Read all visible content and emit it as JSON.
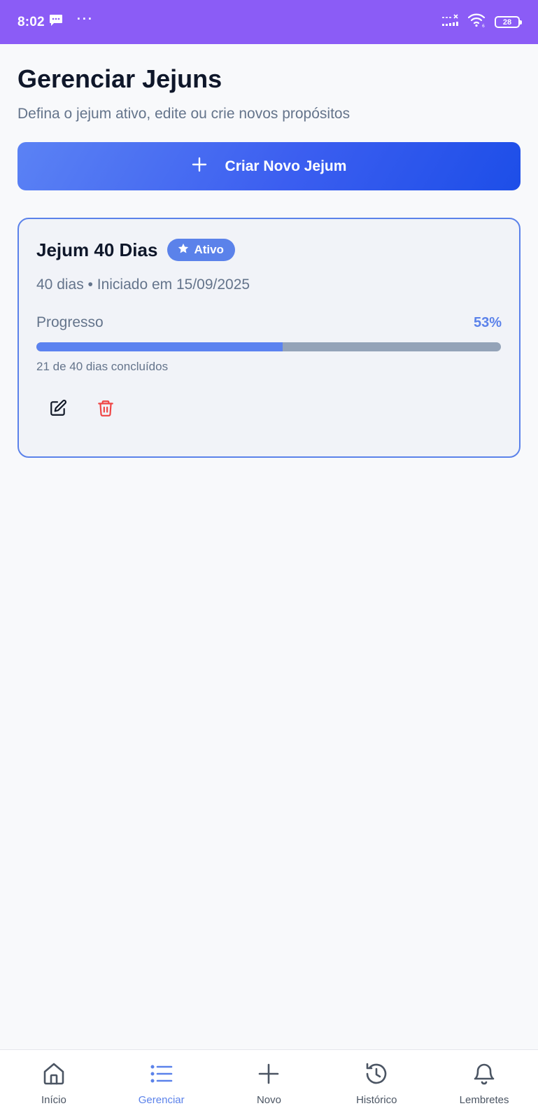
{
  "status_bar": {
    "time": "8:02",
    "overflow": "···",
    "battery": "28",
    "icons": [
      "message-icon",
      "signal-icon",
      "wifi-icon",
      "battery-icon"
    ],
    "background": "#8b5cf6"
  },
  "page": {
    "title": "Gerenciar Jejuns",
    "subtitle": "Defina o jejum ativo, edite ou crie novos propósitos"
  },
  "create_button": {
    "icon": "plus-icon",
    "label": "Criar Novo Jejum"
  },
  "fasts": [
    {
      "title": "Jejum 40 Dias",
      "badge": "Ativo",
      "badge_icon": "star-icon",
      "meta": "40 dias • Iniciado em 15/09/2025",
      "progress_label": "Progresso",
      "progress_percent_text": "53%",
      "progress_fraction": 0.53,
      "progress_caption": "21 de 40 dias concluídos",
      "actions": [
        "edit-icon",
        "trash-icon"
      ]
    }
  ],
  "bottom_nav": {
    "items": [
      {
        "label": "Início",
        "icon": "home-icon",
        "active": false
      },
      {
        "label": "Gerenciar",
        "icon": "list-icon",
        "active": true
      },
      {
        "label": "Novo",
        "icon": "plus-icon",
        "active": false
      },
      {
        "label": "Histórico",
        "icon": "history-icon",
        "active": false
      },
      {
        "label": "Lembretes",
        "icon": "bell-icon",
        "active": false
      }
    ]
  },
  "colors": {
    "accent": "#5b82ea",
    "danger": "#ef4444",
    "text_primary": "#0f172a",
    "text_secondary": "#64748b"
  }
}
